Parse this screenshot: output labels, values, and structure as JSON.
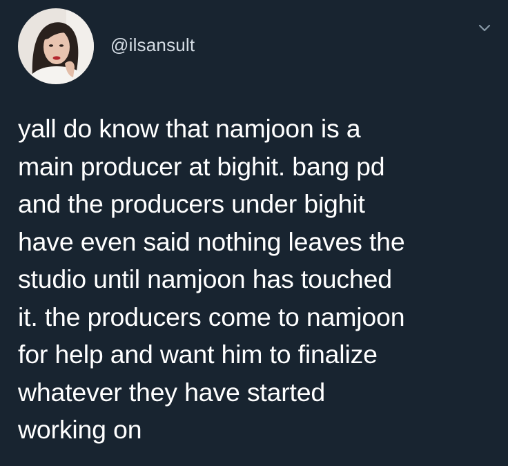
{
  "tweet": {
    "handle": "@ilsansult",
    "text": "yall do know that namjoon is a\nmain producer at bighit. bang pd\nand the producers under bighit\nhave even said nothing leaves the\nstudio until namjoon has touched\nit. the producers come to namjoon\nfor help and want him to finalize\nwhatever they have started\nworking on"
  },
  "icons": {
    "menu": "chevron-down-icon"
  },
  "colors": {
    "background": "#182430",
    "text": "#ffffff",
    "handle": "#d5dde5",
    "chevron": "#8899a6"
  }
}
